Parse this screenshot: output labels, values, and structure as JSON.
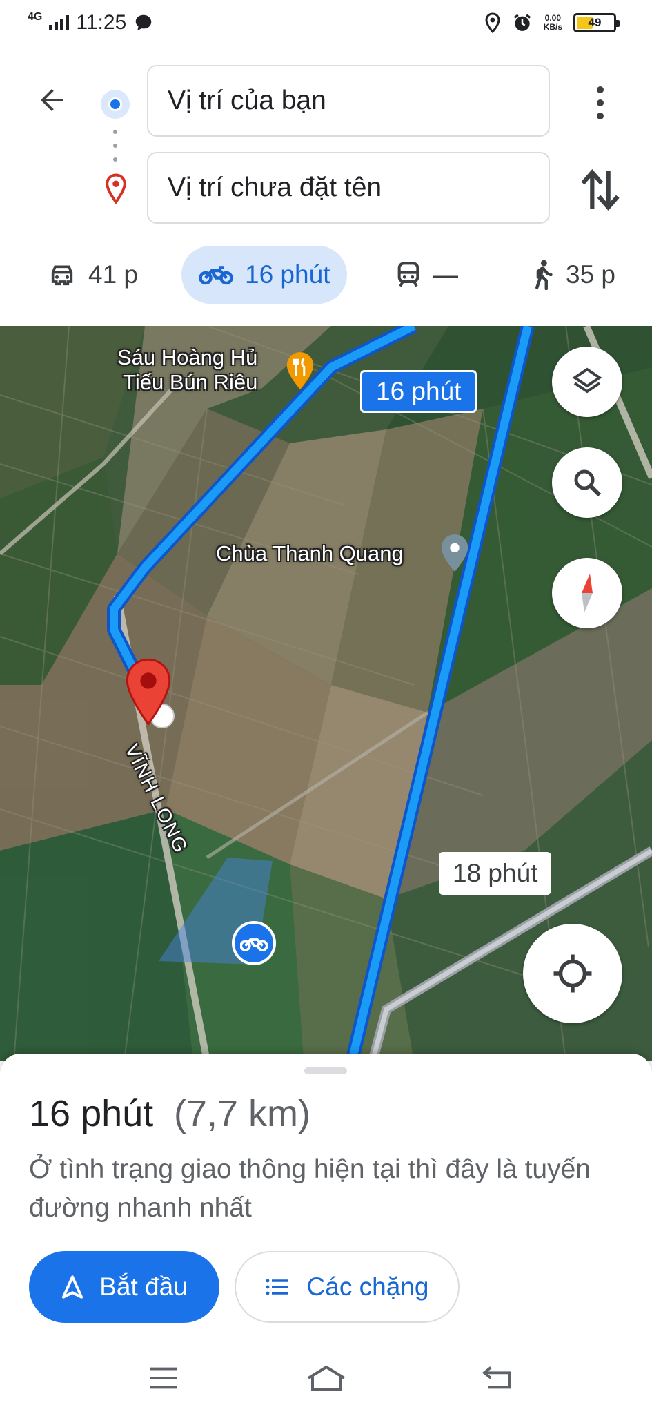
{
  "status_bar": {
    "network": "4G",
    "time": "11:25",
    "rate_value": "0.00",
    "rate_unit": "KB/s",
    "battery": "49",
    "battery_level": 0.49,
    "icons": [
      "chat-bubble-icon",
      "location-icon",
      "alarm-icon"
    ]
  },
  "directions": {
    "origin": "Vị trí của bạn",
    "destination": "Vị trí chưa đặt tên"
  },
  "modes": [
    {
      "icon": "car-icon",
      "label": "41 p"
    },
    {
      "icon": "motorbike-icon",
      "label": "16 phút",
      "selected": true
    },
    {
      "icon": "transit-icon",
      "label": "—"
    },
    {
      "icon": "walk-icon",
      "label": "35 p"
    }
  ],
  "map": {
    "labels": {
      "restaurant_line1": "Sáu Hoàng Hủ",
      "restaurant_line2": "Tiếu Bún Riêu",
      "pagoda": "Chùa Thanh Quang",
      "province": "VĨNH LONG"
    },
    "eta_main": "16 phút",
    "eta_alt": "18 phút",
    "route_color": "#1a73e8",
    "alt_route_color": "#9aa0a6",
    "pin_color": "#ea4335"
  },
  "sheet": {
    "duration": "16 phút",
    "distance": "(7,7 km)",
    "description": "Ở tình trạng giao thông hiện tại thì đây là tuyến đường nhanh nhất",
    "start_label": "Bắt đầu",
    "steps_label": "Các chặng"
  },
  "accent": "#1a73e8"
}
